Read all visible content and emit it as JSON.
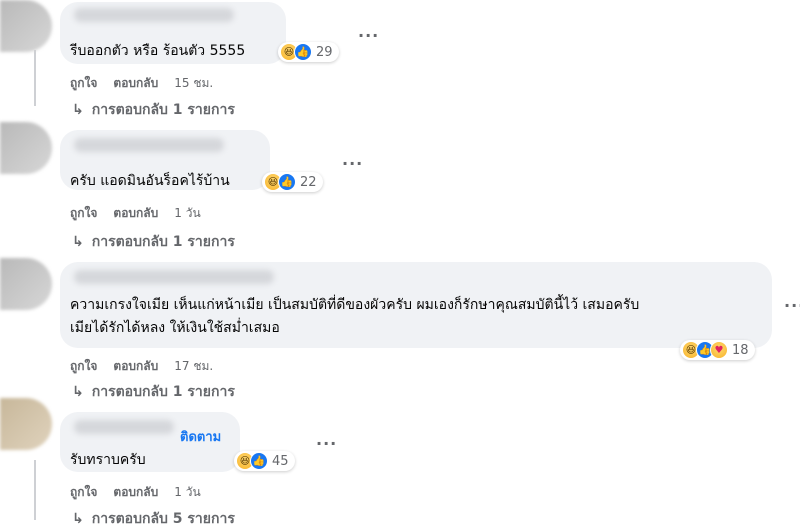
{
  "comments": [
    {
      "text": "รีบออกตัว หรือ ร้อนตัว 5555",
      "reaction_icons": [
        "haha-icon",
        "like-icon"
      ],
      "reaction_count": "29",
      "like_label": "ถูกใจ",
      "reply_label": "ตอบกลับ",
      "time": "15 ชม.",
      "replies_label": "การตอบกลับ 1 รายการ"
    },
    {
      "text": "ครับ แอดมินอันร็อคไร้บ้าน",
      "reaction_icons": [
        "haha-icon",
        "like-icon"
      ],
      "reaction_count": "22",
      "like_label": "ถูกใจ",
      "reply_label": "ตอบกลับ",
      "time": "1 วัน",
      "replies_label": "การตอบกลับ 1 รายการ"
    },
    {
      "text_line1": "ความเกรงใจเมีย เห็นแก่หน้าเมีย เป็นสมบัติที่ดีของผัวครับ ผมเองก็รักษาคุณสมบัตินี้ไว้ เสมอครับ",
      "text_line2": "เมียได้รักได้หลง ให้เงินใช้สม่ำเสมอ",
      "reaction_icons": [
        "haha-icon",
        "like-icon",
        "care-icon"
      ],
      "reaction_count": "18",
      "like_label": "ถูกใจ",
      "reply_label": "ตอบกลับ",
      "time": "17 ชม.",
      "replies_label": "การตอบกลับ 1 รายการ"
    },
    {
      "follow_label": "ติดตาม",
      "text": "รับทราบครับ",
      "reaction_icons": [
        "haha-icon",
        "like-icon"
      ],
      "reaction_count": "45",
      "like_label": "ถูกใจ",
      "reply_label": "ตอบกลับ",
      "time": "1 วัน",
      "replies_label": "การตอบกลับ 5 รายการ"
    }
  ],
  "more_options": "···",
  "reply_arrow": "↳"
}
